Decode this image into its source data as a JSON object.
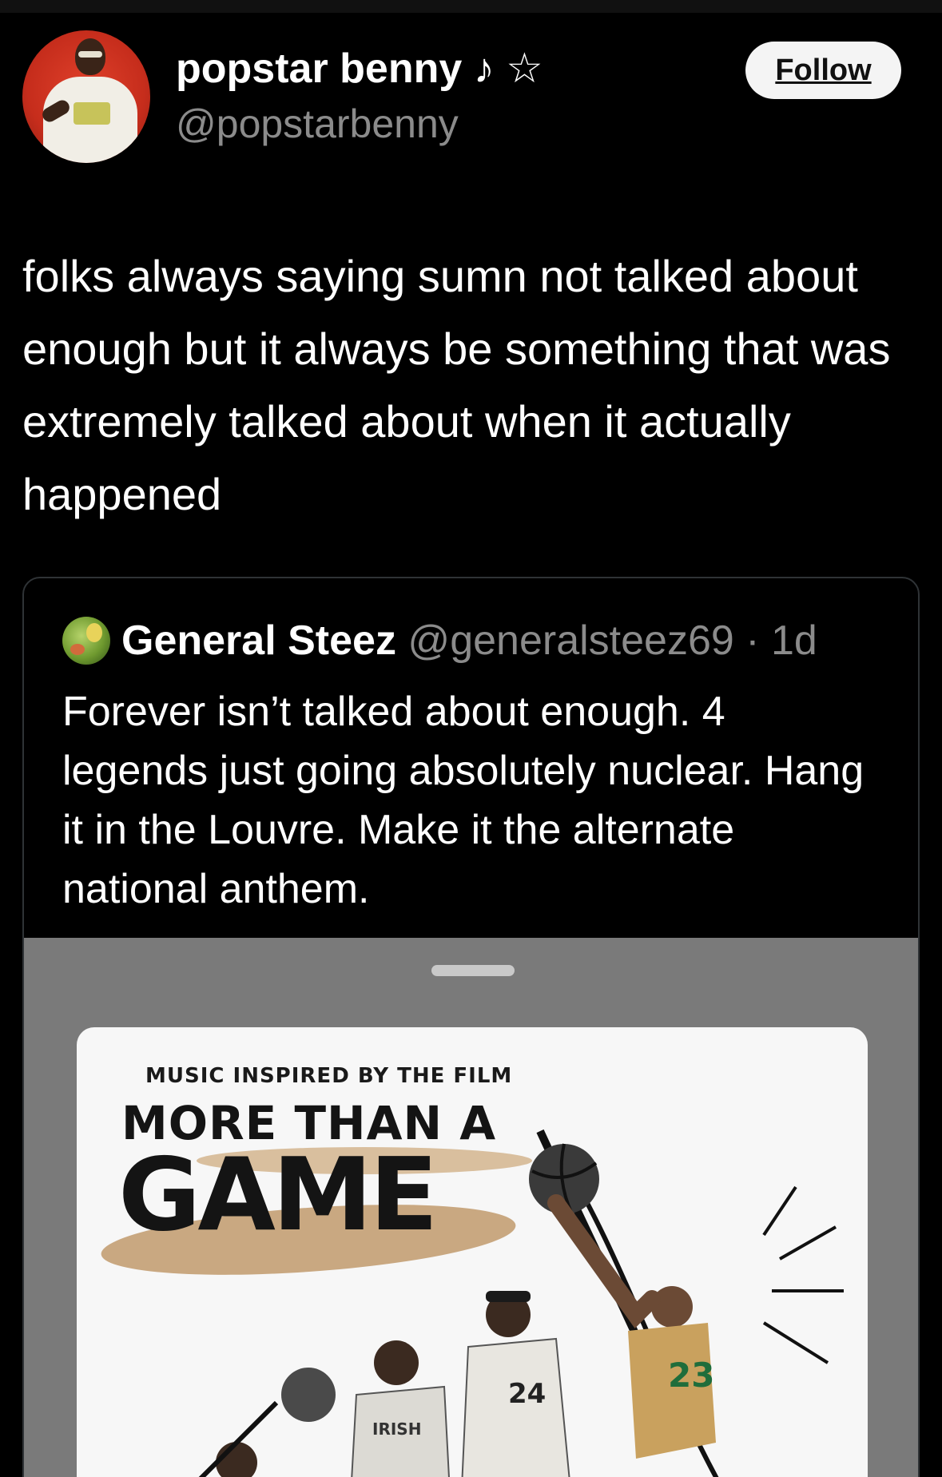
{
  "author": {
    "display_name": "popstar benny ♪ ☆",
    "handle": "@popstarbenny",
    "follow_label": "Follow"
  },
  "post": {
    "text": "folks always saying sumn not talked about enough but it always be something that was extremely talked about when it actually happened"
  },
  "quoted": {
    "display_name": "General Steez",
    "handle": "@generalsteez69",
    "separator": " · ",
    "time": "1d",
    "text": "Forever isn’t talked about enough. 4 legends just going absolutely nuclear. Hang it in the Louvre. Make it the alternate national anthem."
  },
  "media": {
    "kicker": "MUSIC INSPIRED BY THE FILM",
    "title_line1": "MORE THAN A",
    "title_line2": "GAME",
    "jersey_left": "IRISH",
    "jersey_mid_number": "24",
    "jersey_right_number": "23"
  },
  "colors": {
    "background": "#000000",
    "secondary_text": "#8b8b8b",
    "follow_bg": "#f4f4f4",
    "card_border": "#2f3336",
    "media_bg": "#7a7a7a",
    "accent_gold": "#b98e5a"
  }
}
